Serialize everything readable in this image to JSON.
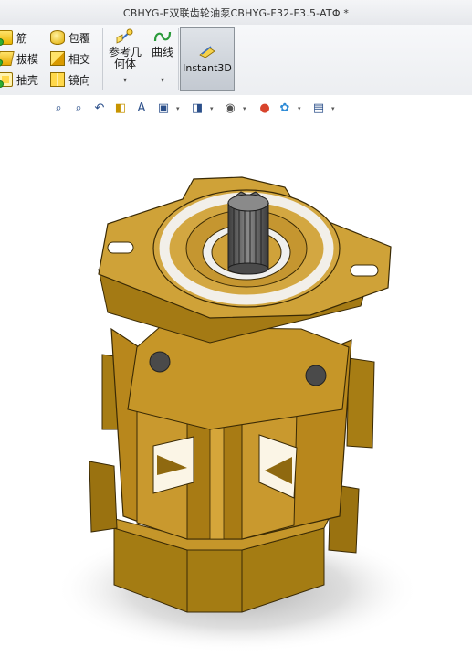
{
  "window": {
    "title": "CBHYG-F双联齿轮油泵CBHYG-F32-F3.5-ATΦ *"
  },
  "ribbon": {
    "col1": [
      {
        "label": "筋",
        "icon": "rib-icon"
      },
      {
        "label": "拔模",
        "icon": "draft-icon"
      },
      {
        "label": "抽壳",
        "icon": "shell-icon"
      }
    ],
    "col2": [
      {
        "label": "包覆",
        "icon": "wrap-icon"
      },
      {
        "label": "相交",
        "icon": "intersect-icon"
      },
      {
        "label": "镜向",
        "icon": "mirror-icon"
      }
    ],
    "ref_geometry": {
      "label_line1": "参考几",
      "label_line2": "何体",
      "icon": "reference-geometry-icon"
    },
    "curves": {
      "label": "曲线",
      "icon": "curves-icon"
    },
    "instant3d": {
      "label": "Instant3D",
      "icon": "instant3d-icon",
      "active": true
    }
  },
  "view_toolbar": [
    "zoom-to-fit-icon",
    "zoom-to-area-icon",
    "previous-view-icon",
    "section-view-icon",
    "dynamic-annotation-icon",
    "view-orientation-icon",
    "display-style-icon",
    "hide-show-items-icon",
    "edit-appearance-icon",
    "apply-scene-icon",
    "view-settings-icon"
  ],
  "model": {
    "name": "gear pump model",
    "color": "#b8860b"
  }
}
